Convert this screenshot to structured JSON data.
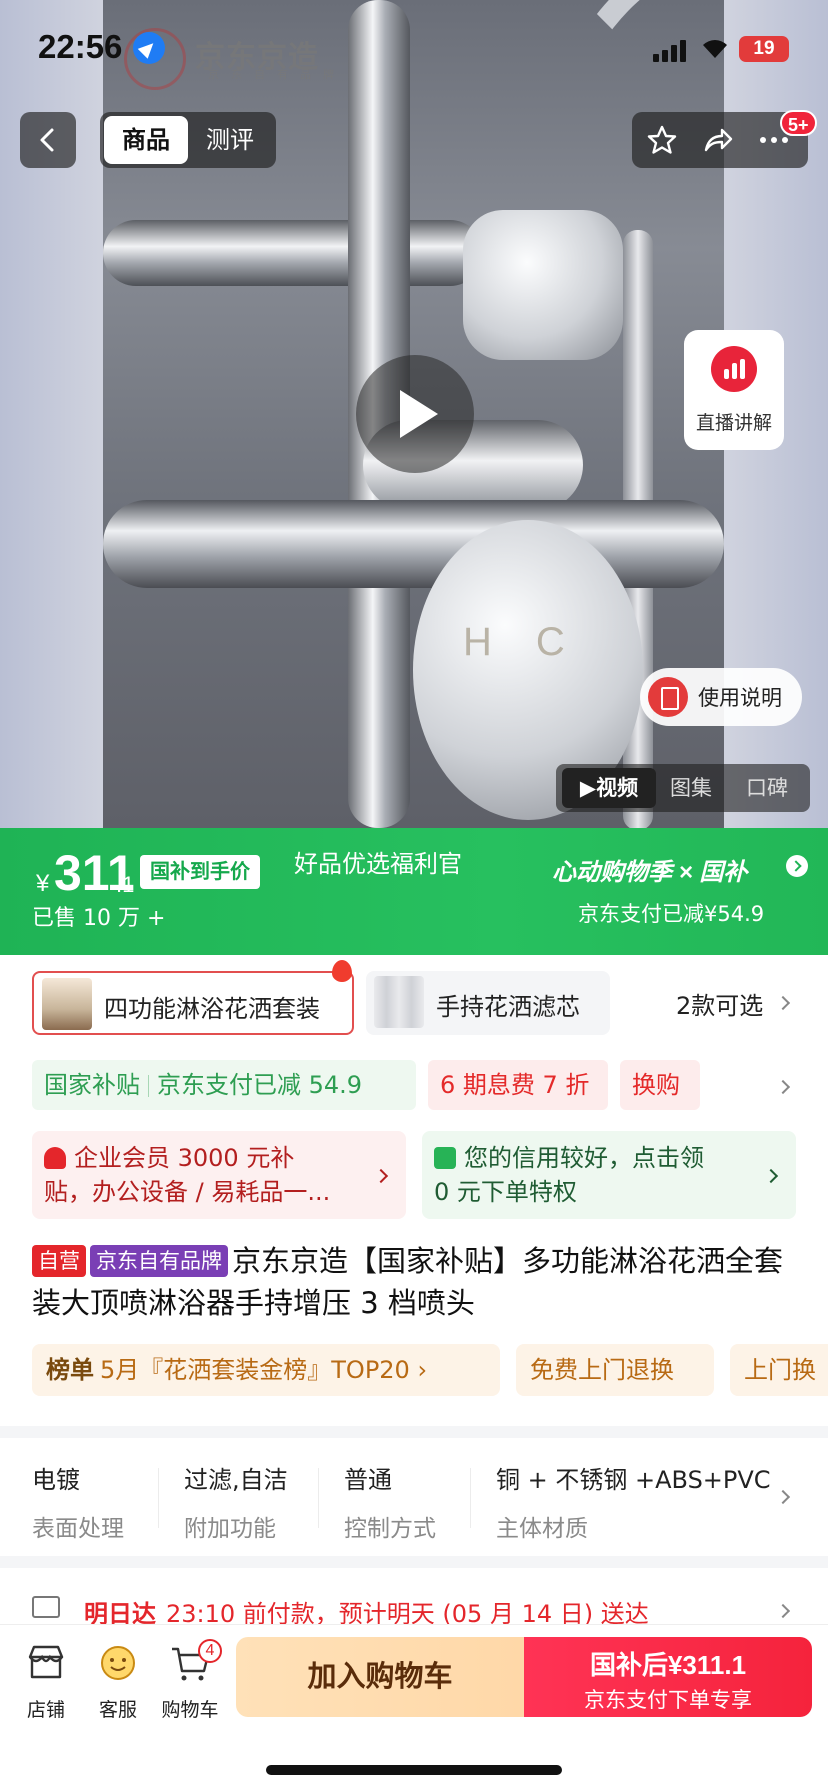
{
  "status_bar": {
    "time": "22:56",
    "battery": "19"
  },
  "watermark": {
    "logo": "京东京造",
    "sub": "京东自有品牌"
  },
  "nav": {
    "tabs": [
      "商品",
      "测评"
    ],
    "notif_badge": "5+"
  },
  "hero": {
    "live_label": "直播讲解",
    "manual_label": "使用说明",
    "media_tabs": [
      "视频",
      "图集",
      "口碑"
    ],
    "active_media_tab": "视频"
  },
  "price_bar": {
    "currency": "¥",
    "price_int": "311",
    "price_dec": ".1",
    "subsidy_tag": "国补到手价",
    "sold": "已售 10 万 +",
    "welfare": "好品优选福利官",
    "season": "心动购物季 × 国补",
    "reduced": "京东支付已减¥54.9"
  },
  "variants": {
    "items": [
      "四功能淋浴花洒套装",
      "手持花洒滤芯"
    ],
    "count": "2款可选"
  },
  "promos": {
    "green_a": "国家补贴",
    "green_b": "京东支付已减 54.9",
    "installment": "6 期息费 7 折",
    "exchange": "换购"
  },
  "cards": {
    "enterprise_1": "企业会员 3000 元补",
    "enterprise_2": "贴，办公设备 / 易耗品一...",
    "credit_1": "您的信用较好，点击领",
    "credit_2": "0 元下单特权"
  },
  "product": {
    "tag_self": "自营",
    "tag_brand": "京东自有品牌",
    "title": "京东京造【国家补贴】多功能淋浴花洒全套装大顶喷淋浴器手持增压 3 档喷头"
  },
  "ranks": {
    "label": "榜单",
    "rank_text": "5月『花洒套装金榜』TOP20 ›",
    "free_return": "免费上门退换",
    "door_exchange": "上门换"
  },
  "specs": [
    {
      "value": "电镀",
      "key": "表面处理"
    },
    {
      "value": "过滤,自洁",
      "key": "附加功能"
    },
    {
      "value": "普通",
      "key": "控制方式"
    },
    {
      "value": "铜 + 不锈钢 +ABS+PVC",
      "key": "主体材质"
    }
  ],
  "delivery": {
    "label": "明日达",
    "text": "23:10 前付款，预计明天 (05 月 14 日) 送达"
  },
  "bottom_bar": {
    "store": "店铺",
    "service": "客服",
    "cart": "购物车",
    "cart_count": "4",
    "add_cart": "加入购物车",
    "buy_line1": "国补后¥311.1",
    "buy_line2": "京东支付下单专享"
  },
  "colors": {
    "brand_red": "#e4262b",
    "green": "#1fb355",
    "accent_orange": "#ffd8a8"
  }
}
